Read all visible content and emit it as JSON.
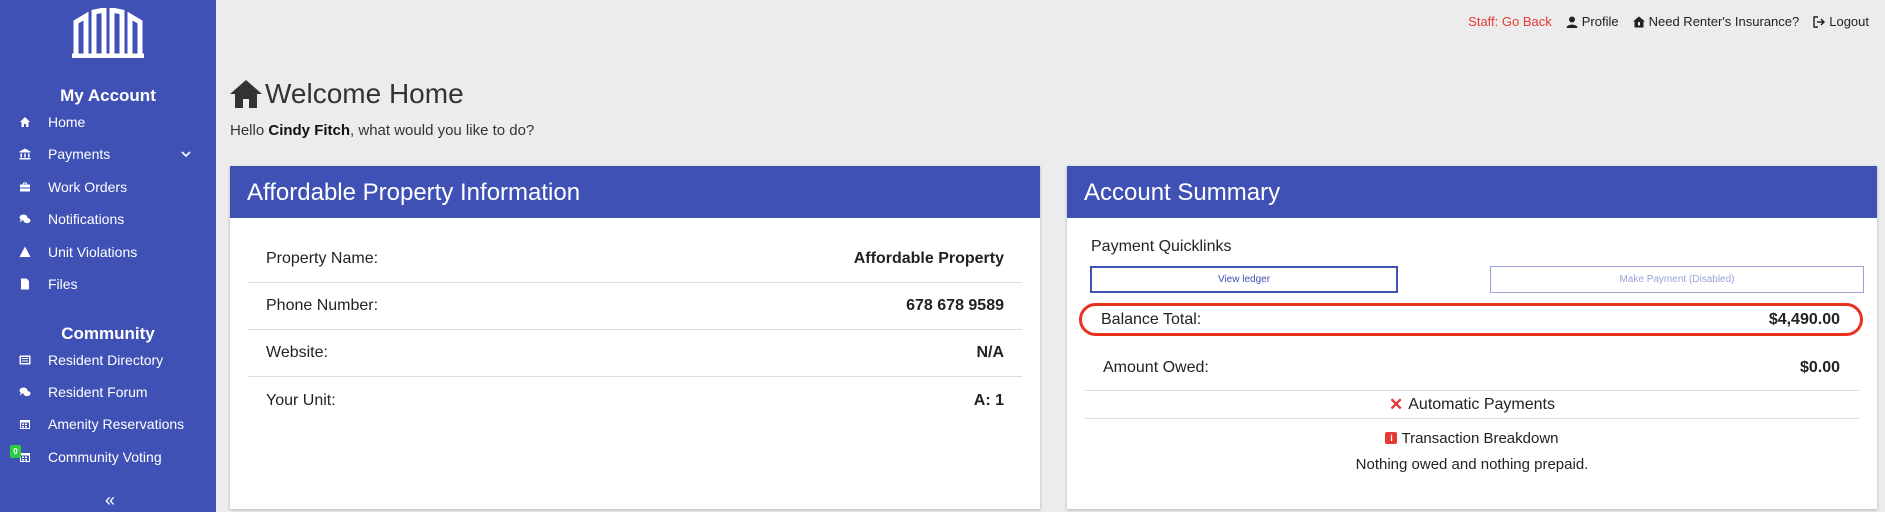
{
  "sidebar": {
    "my_account_title": "My Account",
    "account_items": [
      {
        "label": "Home",
        "icon": "home-icon"
      },
      {
        "label": "Payments",
        "icon": "bank-icon"
      },
      {
        "label": "Work Orders",
        "icon": "toolbox-icon"
      },
      {
        "label": "Notifications",
        "icon": "chat-icon"
      },
      {
        "label": "Unit Violations",
        "icon": "warning-icon"
      },
      {
        "label": "Files",
        "icon": "file-icon"
      }
    ],
    "community_title": "Community",
    "community_items": [
      {
        "label": "Resident Directory",
        "icon": "directory-icon"
      },
      {
        "label": "Resident Forum",
        "icon": "chat-icon"
      },
      {
        "label": "Amenity Reservations",
        "icon": "calendar-icon"
      },
      {
        "label": "Community Voting",
        "icon": "calendar-icon"
      }
    ],
    "voting_badge": "0",
    "collapse_label": "«"
  },
  "topbar": {
    "staff_back": "Staff: Go Back",
    "profile": "Profile",
    "insurance": "Need Renter's Insurance?",
    "logout": "Logout"
  },
  "welcome": {
    "title": "Welcome Home",
    "hello_prefix": "Hello ",
    "user_name": "Cindy Fitch",
    "hello_suffix": ", what would you like to do?"
  },
  "property_card": {
    "title": "Affordable Property Information",
    "rows": [
      {
        "label": "Property Name:",
        "value": "Affordable Property"
      },
      {
        "label": "Phone Number:",
        "value": "678 678 9589"
      },
      {
        "label": "Website:",
        "value": "N/A"
      },
      {
        "label": "Your Unit:",
        "value": "A: 1"
      }
    ]
  },
  "account_card": {
    "title": "Account Summary",
    "quicklinks_title": "Payment Quicklinks",
    "view_ledger": "View ledger",
    "make_payment": "Make Payment (Disabled)",
    "balance_label": "Balance Total:",
    "balance_value": "$4,490.00",
    "owed_label": "Amount Owed:",
    "owed_value": "$0.00",
    "auto_payments_mark": "✕",
    "auto_payments": "Automatic Payments",
    "transaction_icon": "i",
    "transaction_breakdown": "Transaction Breakdown",
    "nothing_text": "Nothing owed and nothing prepaid."
  },
  "colors": {
    "brand": "#3f51b5",
    "alert": "#e53935",
    "highlight": "#e8321e"
  }
}
